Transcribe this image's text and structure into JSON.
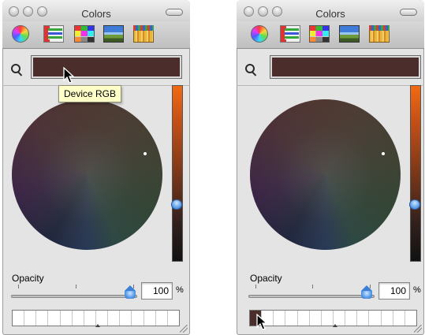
{
  "left_panel": {
    "title": "Colors",
    "tooltip": "Device RGB",
    "current_color": "#4b2d2c",
    "opacity_label": "Opacity",
    "opacity_value": "100",
    "opacity_unit": "%"
  },
  "right_panel": {
    "title": "Colors",
    "current_color": "#4b2d2c",
    "opacity_label": "Opacity",
    "opacity_value": "100",
    "opacity_unit": "%"
  },
  "toolbar_icons": [
    "color-wheel-icon",
    "color-sliders-icon",
    "color-palettes-icon",
    "image-palettes-icon",
    "crayons-icon"
  ],
  "colors": {
    "brightness_top": "#f26a12",
    "accent": "#3c7fd6",
    "selected_swatch": "#4b2d2c"
  }
}
